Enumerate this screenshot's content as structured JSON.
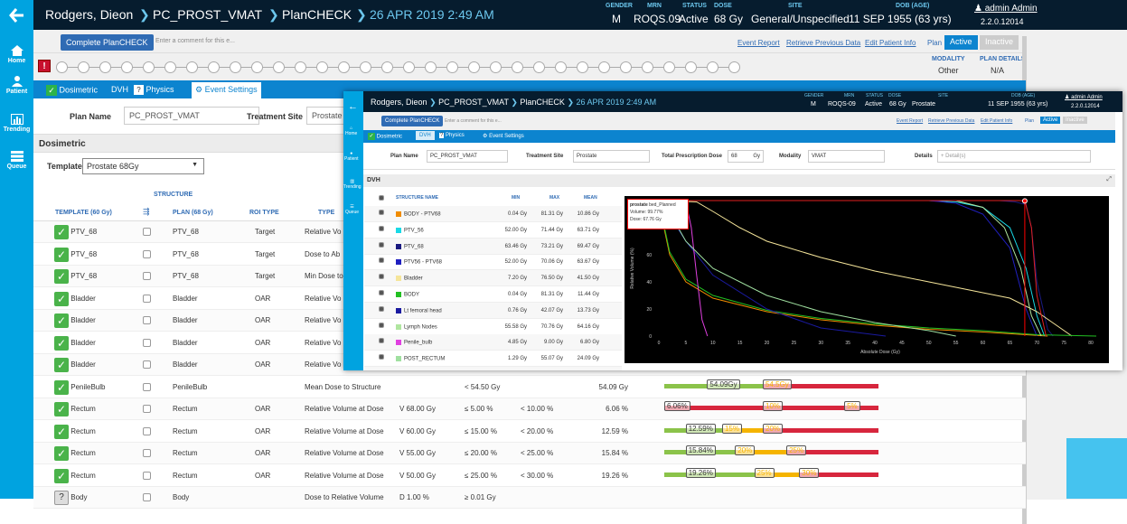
{
  "nav": [
    {
      "label": "Home",
      "icon": "home-icon"
    },
    {
      "label": "Patient",
      "icon": "patient-icon"
    },
    {
      "label": "Trending",
      "icon": "trending-icon"
    },
    {
      "label": "Queue",
      "icon": "queue-icon"
    }
  ],
  "header": {
    "patient": "Rodgers, Dieon",
    "plan": "PC_PROST_VMAT",
    "page": "PlanCHECK",
    "datetime": "26 APR 2019 2:49 AM",
    "gender_label": "GENDER",
    "gender": "M",
    "mrn_label": "MRN",
    "mrn": "ROQS.09",
    "status_label": "STATUS",
    "status": "Active",
    "dose_label": "DOSE",
    "dose": "68 Gy",
    "site_label": "SITE",
    "site": "General/Unspecified",
    "dob_label": "DOB (AGE)",
    "dob": "11 SEP 1955 (63 yrs)",
    "user": "admin Admin",
    "version": "2.2.0.12014"
  },
  "commentbar": {
    "complete": "Complete PlanCHECK",
    "placeholder": "Enter a comment for this e...",
    "event_report": "Event Report",
    "retrieve": "Retrieve Previous Data",
    "edit_patient": "Edit Patient Info",
    "plan": "Plan",
    "active": "Active",
    "inactive": "Inactive"
  },
  "modality": {
    "label": "MODALITY",
    "value": "Other",
    "details_label": "PLAN DETAILS",
    "details": "N/A"
  },
  "tabs": {
    "dosimetric": "Dosimetric",
    "dvh": "DVH",
    "physics": "Physics",
    "events": "Event Settings"
  },
  "form": {
    "plan_name_label": "Plan Name",
    "plan_name": "PC_PROST_VMAT",
    "site_label": "Treatment Site",
    "site": "Prostate"
  },
  "section": {
    "title": "Dosimetric",
    "template_label": "Template",
    "template": "Prostate 68Gy"
  },
  "table": {
    "structure_header": "STRUCTURE",
    "template_header": "TEMPLATE (60 Gy)",
    "plan_header": "PLAN (68 Gy)",
    "roi_header": "ROI TYPE",
    "type_header": "TYPE",
    "rows": [
      {
        "check": "ok",
        "template": "PTV_68",
        "plan": "PTV_68",
        "roi": "Target",
        "type": "Relative Vo",
        "param": "",
        "goal": "",
        "var": "",
        "actual": ""
      },
      {
        "check": "ok",
        "template": "PTV_68",
        "plan": "PTV_68",
        "roi": "Target",
        "type": "Dose to Ab",
        "param": "",
        "goal": "",
        "var": "",
        "actual": ""
      },
      {
        "check": "ok",
        "template": "PTV_68",
        "plan": "PTV_68",
        "roi": "Target",
        "type": "Min Dose to",
        "param": "",
        "goal": "",
        "var": "",
        "actual": ""
      },
      {
        "check": "ok",
        "template": "Bladder",
        "plan": "Bladder",
        "roi": "OAR",
        "type": "Relative Vo",
        "param": "",
        "goal": "",
        "var": "",
        "actual": ""
      },
      {
        "check": "ok",
        "template": "Bladder",
        "plan": "Bladder",
        "roi": "OAR",
        "type": "Relative Vo",
        "param": "",
        "goal": "",
        "var": "",
        "actual": ""
      },
      {
        "check": "ok",
        "template": "Bladder",
        "plan": "Bladder",
        "roi": "OAR",
        "type": "Relative Vo",
        "param": "",
        "goal": "",
        "var": "",
        "actual": ""
      },
      {
        "check": "ok",
        "template": "Bladder",
        "plan": "Bladder",
        "roi": "OAR",
        "type": "Relative Vo",
        "param": "",
        "goal": "",
        "var": "",
        "actual": ""
      },
      {
        "check": "ok",
        "template": "PenileBulb",
        "plan": "PenileBulb",
        "roi": "",
        "type": "Mean Dose to Structure",
        "param": "",
        "goal": "< 54.50 Gy",
        "var": "",
        "actual": "54.09 Gy",
        "bar": {
          "l1": "54.09Gy",
          "l2": "54.5Gy",
          "lmark": 0.2,
          "l2mark": 0.46,
          "g": 0.46,
          "y": 0,
          "r": 0.54
        }
      },
      {
        "check": "ok",
        "template": "Rectum",
        "plan": "Rectum",
        "roi": "OAR",
        "type": "Relative Volume at Dose",
        "param": "V 68.00 Gy",
        "goal": "≤ 5.00 %",
        "var": "< 10.00 %",
        "actual": "6.06 %",
        "bar": {
          "l1": "6.06%",
          "l2": "10%",
          "l3": "5%",
          "lmark": 0.0,
          "l2mark": 0.46,
          "l3mark": 0.84,
          "g": 0,
          "y": 0,
          "r": 1
        }
      },
      {
        "check": "ok",
        "template": "Rectum",
        "plan": "Rectum",
        "roi": "OAR",
        "type": "Relative Volume at Dose",
        "param": "V 60.00 Gy",
        "goal": "≤ 15.00 %",
        "var": "< 20.00 %",
        "actual": "12.59 %",
        "bar": {
          "l1": "12.59%",
          "l2": "15%",
          "l3": "20%",
          "lmark": 0.1,
          "l2mark": 0.27,
          "l3mark": 0.46,
          "g": 0.27,
          "y": 0.19,
          "r": 0.54
        }
      },
      {
        "check": "ok",
        "template": "Rectum",
        "plan": "Rectum",
        "roi": "OAR",
        "type": "Relative Volume at Dose",
        "param": "V 55.00 Gy",
        "goal": "≤ 20.00 %",
        "var": "< 25.00 %",
        "actual": "15.84 %",
        "bar": {
          "l1": "15.84%",
          "l2": "20%",
          "l3": "25%",
          "lmark": 0.1,
          "l2mark": 0.33,
          "l3mark": 0.57,
          "g": 0.33,
          "y": 0.24,
          "r": 0.43
        }
      },
      {
        "check": "ok",
        "template": "Rectum",
        "plan": "Rectum",
        "roi": "OAR",
        "type": "Relative Volume at Dose",
        "param": "V 50.00 Gy",
        "goal": "≤ 25.00 %",
        "var": "< 30.00 %",
        "actual": "19.26 %",
        "bar": {
          "l1": "19.26%",
          "l2": "25%",
          "l3": "30%",
          "lmark": 0.1,
          "l2mark": 0.42,
          "l3mark": 0.63,
          "g": 0.42,
          "y": 0.21,
          "r": 0.37
        }
      },
      {
        "check": "q",
        "template": "Body",
        "plan": "Body",
        "roi": "",
        "type": "Dose to Relative Volume",
        "param": "D 1.00 %",
        "goal": "≥ 0.01 Gy",
        "var": "",
        "actual": ""
      }
    ]
  },
  "overlay": {
    "patient": "Rodgers, Dieon",
    "plan": "PC_PROST_VMAT",
    "page": "PlanCHECK",
    "datetime": "26 APR 2019 2:49 AM",
    "gender": "M",
    "mrn": "ROQS-09",
    "status": "Active",
    "dose": "68 Gy",
    "site": "Prostate",
    "dob": "11 SEP 1955 (63 yrs)",
    "user": "admin Admin",
    "version": "2.2.0.12014",
    "complete": "Complete PlanCHECK",
    "placeholder": "Enter a comment for this e...",
    "event_report": "Event Report",
    "retrieve": "Retrieve Previous Data",
    "edit_patient": "Edit Patient Info",
    "plan_lbl": "Plan",
    "active": "Active",
    "inactive": "Inactive",
    "tabs": {
      "dosimetric": "Dosimetric",
      "dvh": "DVH",
      "physics": "Physics",
      "events": "Event Settings"
    },
    "plan_name_label": "Plan Name",
    "plan_name": "PC_PROST_VMAT",
    "site_label": "Treatment Site",
    "tpd_label": "Total Prescription Dose",
    "tpd": "68",
    "tpd_unit": "Gy",
    "modality_label": "Modality",
    "modality": "VMAT",
    "details_label": "Details",
    "details_placeholder": "+ Detail(s)",
    "dvh_title": "DVH",
    "cols": {
      "name": "STRUCTURE NAME",
      "min": "MIN",
      "max": "MAX",
      "mean": "MEAN"
    },
    "structures": [
      {
        "name": "BODY - PTV68",
        "color": "#f08c00",
        "min": "0.04 Gy",
        "max": "81.31 Gy",
        "mean": "10.86 Gy"
      },
      {
        "name": "PTV_56",
        "color": "#19d9e6",
        "min": "52.00 Gy",
        "max": "71.44 Gy",
        "mean": "63.71 Gy"
      },
      {
        "name": "PTV_68",
        "color": "#1a1a80",
        "min": "63.46 Gy",
        "max": "73.21 Gy",
        "mean": "69.47 Gy"
      },
      {
        "name": "PTV56 - PTV68",
        "color": "#2020c0",
        "min": "52.00 Gy",
        "max": "70.06 Gy",
        "mean": "63.67 Gy"
      },
      {
        "name": "Bladder",
        "color": "#f5e59a",
        "min": "7.20 Gy",
        "max": "76.50 Gy",
        "mean": "41.50 Gy"
      },
      {
        "name": "BODY",
        "color": "#22c022",
        "min": "0.04 Gy",
        "max": "81.31 Gy",
        "mean": "11.44 Gy"
      },
      {
        "name": "Lt femoral head",
        "color": "#1a1aa0",
        "min": "0.76 Gy",
        "max": "42.07 Gy",
        "mean": "13.73 Gy"
      },
      {
        "name": "Lymph Nodes",
        "color": "#b0e6a0",
        "min": "55.58 Gy",
        "max": "70.76 Gy",
        "mean": "64.16 Gy"
      },
      {
        "name": "Penile_bulb",
        "color": "#e040e0",
        "min": "4.85 Gy",
        "max": "9.00 Gy",
        "mean": "6.80 Gy"
      },
      {
        "name": "POST_RECTUM",
        "color": "#a0e0a0",
        "min": "1.29 Gy",
        "max": "55.07 Gy",
        "mean": "24.09 Gy"
      },
      {
        "name": "prostate_bed",
        "color": "#e02020",
        "min": "66.75 Gy",
        "max": "71.67 Gy",
        "mean": "69.40 Gy"
      }
    ],
    "tooltip": {
      "name": "prostate",
      "suffix": "bed_Planned",
      "volume": "Volume: 99.77%",
      "dose": "Dose: 67.76 Gy"
    },
    "chart_data": {
      "type": "line",
      "xlabel": "Absolute Dose (Gy)",
      "ylabel": "Relative Volume (%)",
      "xlim": [
        0,
        82
      ],
      "ylim": [
        0,
        100
      ],
      "xticks": [
        "0",
        "5",
        "10",
        "15",
        "20",
        "25",
        "30",
        "35",
        "40",
        "45",
        "50",
        "55",
        "60",
        "65",
        "70",
        "75",
        "80"
      ],
      "yticks": [
        "0",
        "20",
        "40",
        "60",
        "80"
      ],
      "series": [
        {
          "name": "BODY - PTV68",
          "color": "#f08c00",
          "x": [
            0,
            2,
            5,
            10,
            20,
            30,
            40,
            50,
            60,
            68,
            72
          ],
          "y": [
            98,
            60,
            40,
            28,
            18,
            12,
            8,
            5,
            3,
            1,
            0
          ]
        },
        {
          "name": "PTV_56",
          "color": "#19d9e6",
          "x": [
            0,
            50,
            55,
            60,
            65,
            68,
            70,
            71.4
          ],
          "y": [
            100,
            100,
            99,
            95,
            80,
            50,
            15,
            0
          ]
        },
        {
          "name": "PTV_68",
          "color": "#1a1a80",
          "x": [
            0,
            63,
            66,
            68,
            69,
            70,
            72,
            73
          ],
          "y": [
            100,
            100,
            99,
            97,
            80,
            40,
            5,
            0
          ]
        },
        {
          "name": "PTV56 - PTV68",
          "color": "#2020c0",
          "x": [
            0,
            50,
            55,
            60,
            65,
            68,
            70
          ],
          "y": [
            100,
            100,
            98,
            90,
            65,
            20,
            0
          ]
        },
        {
          "name": "Bladder",
          "color": "#f5e59a",
          "x": [
            0,
            7,
            10,
            15,
            20,
            30,
            40,
            50,
            60,
            65,
            70,
            76.5
          ],
          "y": [
            100,
            99,
            92,
            80,
            70,
            58,
            48,
            40,
            32,
            28,
            18,
            0
          ]
        },
        {
          "name": "BODY",
          "color": "#22c022",
          "x": [
            0,
            2,
            5,
            10,
            20,
            30,
            40,
            50,
            60,
            70,
            81
          ],
          "y": [
            100,
            62,
            42,
            30,
            19,
            13,
            9,
            6,
            4,
            1,
            0
          ]
        },
        {
          "name": "Lt femoral head",
          "color": "#1a1aa0",
          "x": [
            0,
            1,
            5,
            10,
            20,
            30,
            42
          ],
          "y": [
            100,
            95,
            70,
            45,
            20,
            6,
            0
          ]
        },
        {
          "name": "Lymph Nodes",
          "color": "#b0e6a0",
          "x": [
            0,
            55,
            60,
            64,
            67,
            69,
            70.8
          ],
          "y": [
            100,
            100,
            95,
            80,
            50,
            15,
            0
          ]
        },
        {
          "name": "Penile_bulb",
          "color": "#e040e0",
          "x": [
            0,
            5,
            6,
            7,
            8,
            9
          ],
          "y": [
            100,
            99,
            80,
            45,
            12,
            0
          ]
        },
        {
          "name": "POST_RECTUM",
          "color": "#a0e0a0",
          "x": [
            0,
            1,
            5,
            10,
            20,
            30,
            40,
            50,
            55
          ],
          "y": [
            100,
            98,
            70,
            50,
            30,
            18,
            10,
            4,
            0
          ]
        },
        {
          "name": "prostate_bed",
          "color": "#e02020",
          "x": [
            0,
            66.7,
            67.8,
            69,
            70,
            71.7
          ],
          "y": [
            100,
            100,
            99.8,
            80,
            30,
            0
          ]
        }
      ]
    }
  }
}
